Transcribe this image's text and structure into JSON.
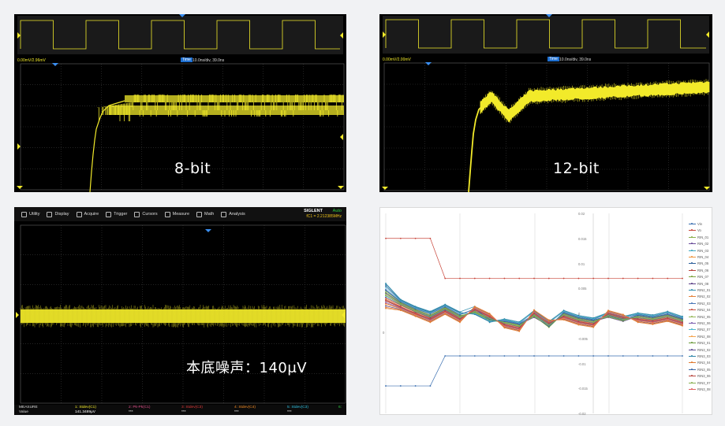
{
  "panel_8bit": {
    "label": "8-bit",
    "header_left": "0.00mV/2.96mV",
    "header_tag": "Time",
    "header_right": "10.0ns/div, 39.0ns",
    "trace_color": "#f2ea2a"
  },
  "panel_12bit": {
    "label": "12-bit",
    "header_left": "0.00mV/2.00mV",
    "header_tag": "Time",
    "header_right": "10.0ns/div, 39.0ns",
    "trace_color": "#f2ea2a"
  },
  "panel_noise": {
    "label": "本底噪声：140μV",
    "toolbar": [
      {
        "label": "Utility"
      },
      {
        "label": "Display"
      },
      {
        "label": "Acquire"
      },
      {
        "label": "Trigger"
      },
      {
        "label": "Cursors"
      },
      {
        "label": "Measure"
      },
      {
        "label": "Math"
      },
      {
        "label": "Analysis"
      }
    ],
    "brand": "SIGLENT",
    "mode": "Auto",
    "sample_rate": "fC1 = 2.212385MHz",
    "measure_title": "MEASURE",
    "value_title": "Value",
    "value": "141.3489μV",
    "measure_items": [
      {
        "label": "1: Stdev(C1)",
        "color": "#f2ea2a",
        "value": "***"
      },
      {
        "label": "2: Pk-Pk(C1)",
        "color": "#e0508a",
        "value": "***"
      },
      {
        "label": "3: Stdev(C3)",
        "color": "#e03a3a",
        "value": "***"
      },
      {
        "label": "4: Stdev(C4)",
        "color": "#f08a24",
        "value": "***"
      },
      {
        "label": "5: Stdev(C3)",
        "color": "#2fc0e0",
        "value": "***"
      },
      {
        "label": "6:",
        "color": "#2ecc40",
        "value": ""
      }
    ]
  },
  "chart_data": {
    "type": "line",
    "y_tick_labels": [
      "0.02",
      "0.015",
      "0.01",
      "0.005",
      "0",
      "-0.005",
      "-0.01",
      "-0.015",
      "-0.02"
    ],
    "ylim": [
      -0.02,
      0.02
    ],
    "x_count": 21,
    "grid": true,
    "legend_position": "right",
    "series": [
      {
        "name": "Vin",
        "color": "#3a6fb0",
        "values": [
          -0.0145,
          -0.0145,
          -0.0145,
          -0.0145,
          -0.0085,
          -0.0085,
          -0.0085,
          -0.0085,
          -0.0085,
          -0.0085,
          -0.0085,
          -0.0085,
          -0.0085,
          -0.0085,
          -0.0085,
          -0.0085,
          -0.0085,
          -0.0085,
          -0.0085,
          -0.0085,
          -0.0085
        ]
      },
      {
        "name": "Vo",
        "color": "#c8453a",
        "values": [
          0.015,
          0.015,
          0.015,
          0.015,
          0.007,
          0.007,
          0.007,
          0.007,
          0.007,
          0.007,
          0.007,
          0.007,
          0.007,
          0.007,
          0.007,
          0.007,
          0.007,
          0.007,
          0.007,
          0.007,
          0.007
        ]
      },
      {
        "name": "RIN_01",
        "color": "#8ab04a",
        "values": [
          0.0045,
          0.0022,
          0.0008,
          -0.0003,
          0.0012,
          -0.0004,
          0.0001,
          -0.0014,
          -0.0018,
          -0.0024,
          -0.0005,
          -0.0028,
          0.0001,
          -0.0009,
          -0.0014,
          -0.0006,
          -0.0014,
          -0.0004,
          -0.0008,
          -0.0002,
          -0.0011
        ]
      },
      {
        "name": "RIN_02",
        "color": "#6b4d9a",
        "values": [
          0.004,
          0.002,
          0.0006,
          -0.0005,
          0.001,
          -0.0006,
          0.0002,
          -0.0012,
          -0.0016,
          -0.0022,
          -0.0008,
          -0.0025,
          -0.0001,
          -0.0011,
          -0.0016,
          -0.0008,
          -0.0016,
          -0.0006,
          -0.001,
          -0.0004,
          -0.0013
        ]
      },
      {
        "name": "RIN_03",
        "color": "#3fa7c0",
        "values": [
          0.0035,
          0.0018,
          0.0004,
          -0.0007,
          0.0008,
          -0.0008,
          0.0004,
          -0.001,
          -0.0019,
          -0.0026,
          -0.0003,
          -0.0023,
          -0.0003,
          -0.0013,
          -0.0018,
          -0.0004,
          -0.0012,
          -0.0008,
          -0.0012,
          -0.0006,
          -0.0015
        ]
      },
      {
        "name": "RIN_04",
        "color": "#f0943a",
        "values": [
          0.003,
          0.0016,
          0.0002,
          -0.0009,
          0.0006,
          -0.001,
          0.0006,
          -0.0008,
          -0.0021,
          -0.0028,
          -0.0001,
          -0.0021,
          -0.0005,
          -0.0015,
          -0.002,
          -0.0002,
          -0.001,
          -0.001,
          -0.0014,
          -0.0008,
          -0.0017
        ]
      },
      {
        "name": "RIN_05",
        "color": "#2b5f9a",
        "values": [
          0.0055,
          0.0026,
          0.0012,
          0.0002,
          0.0016,
          0.0001,
          -0.0001,
          -0.0016,
          -0.0014,
          -0.002,
          0.0004,
          -0.0018,
          0.0003,
          -0.0007,
          -0.0012,
          -0.0001,
          -0.0009,
          -0.0002,
          -0.0006,
          0.0001,
          -0.0009
        ]
      },
      {
        "name": "RIN_06",
        "color": "#b9413a",
        "values": [
          0.0025,
          0.0012,
          0.0001,
          -0.0012,
          0.0004,
          -0.0012,
          0.0008,
          -0.0006,
          -0.0023,
          -0.003,
          0.0001,
          -0.0019,
          -0.0007,
          -0.0017,
          -0.0022,
          0.0,
          -0.0008,
          -0.0012,
          -0.0016,
          -0.001,
          -0.0019
        ]
      },
      {
        "name": "RIN_07",
        "color": "#7da33e",
        "values": [
          0.002,
          0.001,
          -0.0002,
          -0.0014,
          0.0002,
          -0.0014,
          0.001,
          -0.0004,
          -0.0025,
          -0.0032,
          0.0003,
          -0.0017,
          -0.0009,
          -0.0019,
          -0.0024,
          0.0002,
          -0.0006,
          -0.0014,
          -0.0018,
          -0.0012,
          -0.0021
        ]
      },
      {
        "name": "RIN_08",
        "color": "#5a3f86",
        "values": [
          0.0015,
          0.0008,
          -0.0004,
          -0.0016,
          0.0,
          -0.0016,
          0.0012,
          -0.0002,
          -0.0027,
          -0.0034,
          0.0005,
          -0.0015,
          -0.0011,
          -0.0021,
          -0.0026,
          0.0004,
          -0.0004,
          -0.0016,
          -0.002,
          -0.0014,
          -0.0023
        ]
      },
      {
        "name": "RIN2_01",
        "color": "#3590b0",
        "values": [
          0.006,
          0.0028,
          0.0014,
          0.0004,
          0.0018,
          0.0003,
          0.0014,
          -0.0018,
          -0.0012,
          -0.0018,
          0.0006,
          -0.0016,
          0.0005,
          -0.0005,
          -0.001,
          0.0001,
          -0.0007,
          0.0,
          -0.0004,
          0.0003,
          -0.0007
        ]
      },
      {
        "name": "RIN2_02",
        "color": "#e5823a",
        "values": [
          0.001,
          0.0006,
          -0.0006,
          -0.0018,
          -0.0002,
          -0.0018,
          0.0014,
          0.0,
          -0.0029,
          -0.0036,
          0.0007,
          -0.0013,
          -0.0013,
          -0.0023,
          -0.0028,
          0.0006,
          -0.0002,
          -0.0018,
          -0.0022,
          -0.0016,
          -0.0025
        ]
      },
      {
        "name": "RIN2_03",
        "color": "#4a78b8",
        "values": [
          0.0048,
          0.0024,
          0.001,
          0.0,
          0.0014,
          -0.0002,
          0.0009,
          -0.0013,
          -0.0015,
          -0.0021,
          -0.0002,
          -0.0026,
          0.0002,
          -0.0008,
          -0.0013,
          -0.0005,
          -0.0013,
          -0.0003,
          -0.0007,
          -0.0001,
          -0.001
        ]
      },
      {
        "name": "RIN2_04",
        "color": "#c8503f",
        "values": [
          0.0028,
          0.0014,
          0.0,
          -0.001,
          0.0005,
          -0.0011,
          0.0007,
          -0.0007,
          -0.0022,
          -0.0029,
          0.0,
          -0.002,
          -0.0006,
          -0.0016,
          -0.0021,
          -0.0001,
          -0.0009,
          -0.0011,
          -0.0015,
          -0.0009,
          -0.0018
        ]
      },
      {
        "name": "RIN2_05",
        "color": "#96b858",
        "values": [
          0.0038,
          0.0019,
          0.0005,
          -0.0006,
          0.0009,
          -0.0007,
          0.0003,
          -0.0011,
          -0.0018,
          -0.0025,
          -0.0004,
          -0.0024,
          -0.0002,
          -0.0012,
          -0.0017,
          -0.0003,
          -0.0011,
          -0.0007,
          -0.0011,
          -0.0005,
          -0.0014
        ]
      },
      {
        "name": "RIN2_06",
        "color": "#7a5cae",
        "values": [
          0.0022,
          0.0011,
          -0.0001,
          -0.0013,
          0.0003,
          -0.0013,
          0.0009,
          -0.0005,
          -0.0024,
          -0.0031,
          0.0002,
          -0.0018,
          -0.0008,
          -0.0018,
          -0.0023,
          0.0001,
          -0.0007,
          -0.0013,
          -0.0017,
          -0.0011,
          -0.002
        ]
      },
      {
        "name": "RIN2_07",
        "color": "#4fb8d0",
        "values": [
          0.0052,
          0.0025,
          0.0011,
          0.0001,
          0.0015,
          0.0,
          0.0,
          -0.0015,
          -0.0013,
          -0.0019,
          0.0003,
          -0.0019,
          0.0004,
          -0.0006,
          -0.0011,
          0.0,
          -0.0008,
          -0.0001,
          -0.0005,
          0.0002,
          -0.0008
        ]
      },
      {
        "name": "RIN2_08",
        "color": "#f5a650",
        "values": [
          0.0018,
          0.0009,
          -0.0003,
          -0.0015,
          0.0001,
          -0.0015,
          0.0011,
          -0.0003,
          -0.0026,
          -0.0033,
          0.0004,
          -0.0016,
          -0.001,
          -0.002,
          -0.0025,
          0.0003,
          -0.0005,
          -0.0015,
          -0.0019,
          -0.0013,
          -0.0022
        ]
      },
      {
        "name": "RIN3_01",
        "color": "#6a9a3a",
        "values": [
          0.0042,
          0.0021,
          0.0007,
          -0.0004,
          0.0011,
          -0.0005,
          0.0002,
          -0.0013,
          -0.0017,
          -0.0023,
          -0.0006,
          -0.0027,
          0.0,
          -0.001,
          -0.0015,
          -0.0007,
          -0.0015,
          -0.0005,
          -0.0009,
          -0.0003,
          -0.0012
        ]
      },
      {
        "name": "RIN3_02",
        "color": "#5b4a90",
        "values": [
          0.0032,
          0.0017,
          0.0003,
          -0.0008,
          0.0007,
          -0.0009,
          0.0005,
          -0.0009,
          -0.002,
          -0.0027,
          -0.0002,
          -0.0022,
          -0.0004,
          -0.0014,
          -0.0019,
          -0.0003,
          -0.0011,
          -0.0009,
          -0.0013,
          -0.0007,
          -0.0016
        ]
      },
      {
        "name": "RIN3_03",
        "color": "#2f86a8",
        "values": [
          0.0058,
          0.0027,
          0.0013,
          0.0003,
          0.0017,
          0.0002,
          -0.0002,
          -0.0017,
          -0.0011,
          -0.0017,
          0.0005,
          -0.0017,
          0.0006,
          -0.0004,
          -0.0009,
          0.0002,
          -0.0006,
          0.0001,
          -0.0003,
          0.0004,
          -0.0006
        ]
      },
      {
        "name": "RIN3_04",
        "color": "#e07a30",
        "values": [
          0.0012,
          0.0007,
          -0.0005,
          -0.0017,
          -0.0001,
          -0.0017,
          0.0013,
          -0.0001,
          -0.0028,
          -0.0035,
          0.0006,
          -0.0014,
          -0.0012,
          -0.0022,
          -0.0027,
          0.0005,
          -0.0003,
          -0.0017,
          -0.0021,
          -0.0015,
          -0.0024
        ]
      },
      {
        "name": "RIN3_05",
        "color": "#3d6aa8",
        "values": [
          0.0046,
          0.0023,
          0.0009,
          -0.0001,
          0.0013,
          -0.0003,
          0.0009,
          -0.0012,
          -0.0016,
          -0.0022,
          -0.0003,
          -0.0026,
          0.0001,
          -0.0009,
          -0.0014,
          -0.0005,
          -0.0013,
          -0.0004,
          -0.0008,
          -0.0002,
          -0.0011
        ]
      },
      {
        "name": "RIN3_06",
        "color": "#b84840",
        "values": [
          0.0026,
          0.0013,
          -0.0001,
          -0.0011,
          0.0004,
          -0.0012,
          0.0008,
          -0.0006,
          -0.0023,
          -0.003,
          0.0,
          -0.0019,
          -0.0007,
          -0.0017,
          -0.0022,
          0.0,
          -0.0008,
          -0.0012,
          -0.0016,
          -0.001,
          -0.0019
        ]
      },
      {
        "name": "RIN3_07",
        "color": "#88b050",
        "values": [
          0.0036,
          0.0018,
          0.0004,
          -0.0006,
          0.0009,
          -0.0008,
          0.0004,
          -0.001,
          -0.0019,
          -0.0026,
          -0.0003,
          -0.0023,
          -0.0003,
          -0.0013,
          -0.0018,
          -0.0004,
          -0.0012,
          -0.0008,
          -0.0012,
          -0.0006,
          -0.0015
        ]
      },
      {
        "name": "RIN3_08",
        "color": "#e06060",
        "values": [
          0.002,
          0.001,
          -0.0002,
          -0.0014,
          0.0002,
          -0.0014,
          0.001,
          -0.0004,
          -0.0025,
          -0.0032,
          0.0003,
          -0.0017,
          -0.0009,
          -0.0019,
          -0.0024,
          0.0002,
          -0.0006,
          -0.0014,
          -0.0018,
          -0.0012,
          -0.0021
        ]
      }
    ]
  }
}
